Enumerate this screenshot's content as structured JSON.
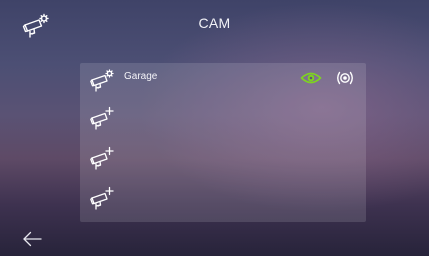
{
  "header": {
    "title": "CAM",
    "settings_icon": "camera-settings-icon"
  },
  "footer": {
    "back_icon": "back-arrow-icon"
  },
  "cameras": [
    {
      "name": "Garage",
      "configured": true,
      "icon": "camera-settings-icon",
      "actions": [
        "eye-icon",
        "monitor-signal-icon"
      ]
    },
    {
      "name": "",
      "configured": false,
      "icon": "camera-add-icon"
    },
    {
      "name": "",
      "configured": false,
      "icon": "camera-add-icon"
    },
    {
      "name": "",
      "configured": false,
      "icon": "camera-add-icon"
    }
  ],
  "colors": {
    "accent_green": "#7ed321",
    "text": "#ffffff"
  }
}
